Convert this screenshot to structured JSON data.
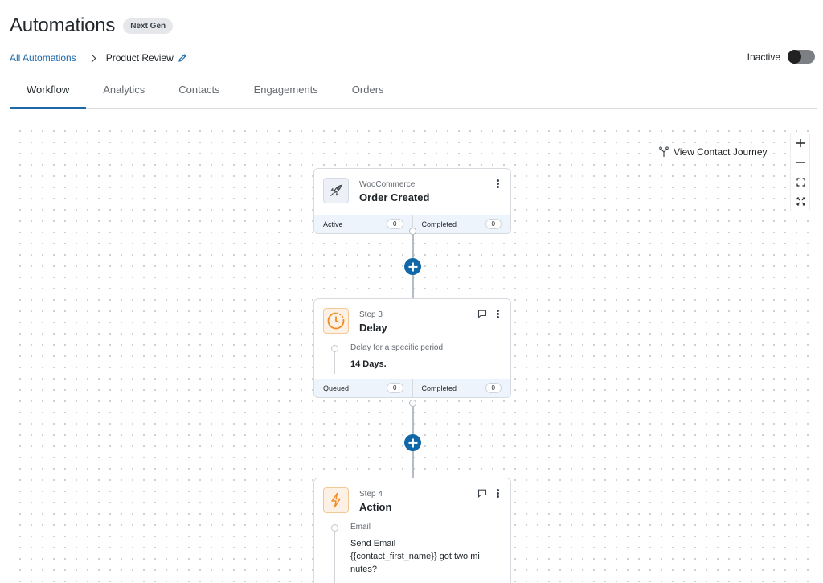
{
  "header": {
    "title": "Automations",
    "badge": "Next Gen"
  },
  "breadcrumb": {
    "root": "All Automations",
    "current": "Product Review"
  },
  "status": {
    "label": "Inactive",
    "enabled": false
  },
  "tabs": [
    {
      "label": "Workflow",
      "active": true
    },
    {
      "label": "Analytics",
      "active": false
    },
    {
      "label": "Contacts",
      "active": false
    },
    {
      "label": "Engagements",
      "active": false
    },
    {
      "label": "Orders",
      "active": false
    }
  ],
  "canvas": {
    "journey_label": "View Contact Journey",
    "zoom_controls": [
      "plus-icon",
      "minus-icon",
      "fit-view-icon",
      "fullscreen-icon"
    ]
  },
  "nodes": [
    {
      "type": "trigger",
      "icon": "rocket-icon",
      "subtitle": "WooCommerce",
      "title": "Order Created",
      "stats": [
        {
          "label": "Active",
          "count": "0"
        },
        {
          "label": "Completed",
          "count": "0"
        }
      ]
    },
    {
      "type": "delay",
      "icon": "clock-icon",
      "subtitle": "Step 3",
      "title": "Delay",
      "body_label": "Delay for a specific period",
      "body_value": "14 Days.",
      "stats": [
        {
          "label": "Queued",
          "count": "0"
        },
        {
          "label": "Completed",
          "count": "0"
        }
      ]
    },
    {
      "type": "action",
      "icon": "lightning-icon",
      "subtitle": "Step 4",
      "title": "Action",
      "body_label": "Email",
      "body_value_1": "Send Email",
      "body_value_2": "{{contact_first_name}} got two mi",
      "body_value_3": "nutes?"
    }
  ],
  "colors": {
    "accent": "#1168a8",
    "link": "#1d68a8",
    "delay_orange": "#f08a24"
  }
}
